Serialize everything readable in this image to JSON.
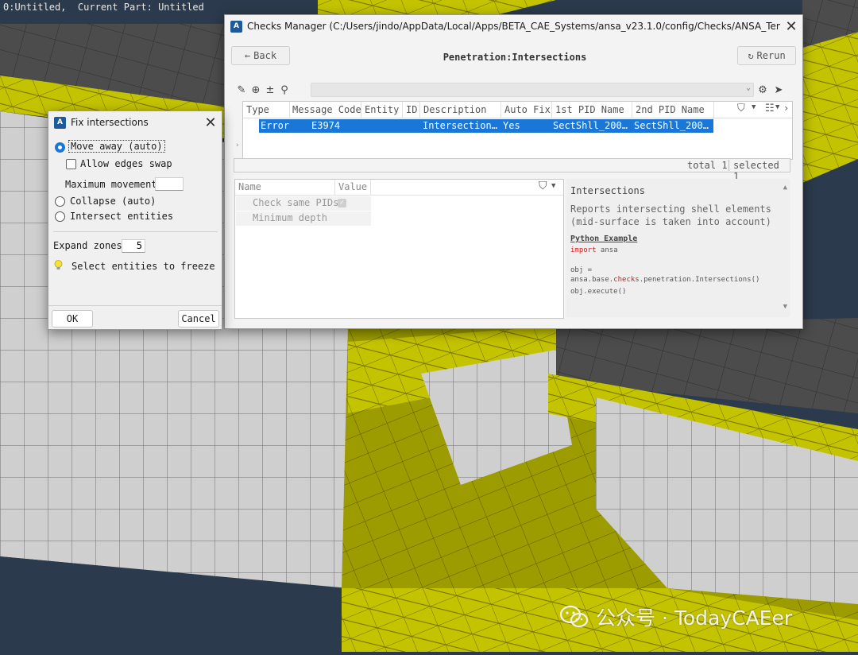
{
  "viewport": {
    "status_text": "0:Untitled,  Current Part: Untitled",
    "colors": {
      "background": "#2b3a4c",
      "shell_yellow": "#c8c600",
      "shell_grey": "#c9c9c9",
      "shell_dark": "#4a4a4a"
    }
  },
  "checks_manager": {
    "title": "Checks Manager (C:/Users/jindo/AppData/Local/Apps/BETA_CAE_Systems/ansa_v23.1.0/config/Checks/ANSA_Templates.pli...",
    "back_label": "Back",
    "header": "Penetration:Intersections",
    "rerun_label": "Rerun",
    "table": {
      "columns": [
        "Type",
        "Message Code",
        "Entity",
        "ID",
        "Description",
        "Auto Fix",
        "1st PID Name",
        "2nd PID Name"
      ],
      "rows": [
        [
          "Error",
          "E3974",
          "",
          "",
          "Intersection…",
          "Yes",
          "SectShll_200…",
          "SectShll_200…"
        ]
      ],
      "status_total": "total 1",
      "status_selected": "selected 1"
    },
    "properties": {
      "columns": [
        "Name",
        "Value"
      ],
      "rows": [
        {
          "name": "Check same PIDs",
          "checked": true
        },
        {
          "name": "Minimum depth"
        }
      ]
    },
    "description": {
      "title": "Intersections",
      "text": "Reports intersecting shell elements (mid-surface is taken into account)",
      "example_label": "Python Example",
      "code_import_kw": "import",
      "code_import_mod": " ansa",
      "code_obj": "obj =",
      "code_call_pre": "ansa.base.",
      "code_call_kw": "checks",
      "code_call_post": ".penetration.Intersections()",
      "code_exec": "obj.execute()"
    }
  },
  "fix_dialog": {
    "title": "Fix intersections",
    "move_away_label": "Move away (auto)",
    "allow_edges_swap_label": "Allow edges swap",
    "max_movement_label": "Maximum movement",
    "max_movement_value": "",
    "collapse_label": "Collapse (auto)",
    "intersect_label": "Intersect entities",
    "expand_zones_label": "Expand zones",
    "expand_zones_value": "5",
    "freeze_label": "Select entities to freeze",
    "ok_label": "OK",
    "cancel_label": "Cancel",
    "selected_option": "move_away"
  },
  "watermark": {
    "text": "公众号 · TodayCAEer"
  }
}
